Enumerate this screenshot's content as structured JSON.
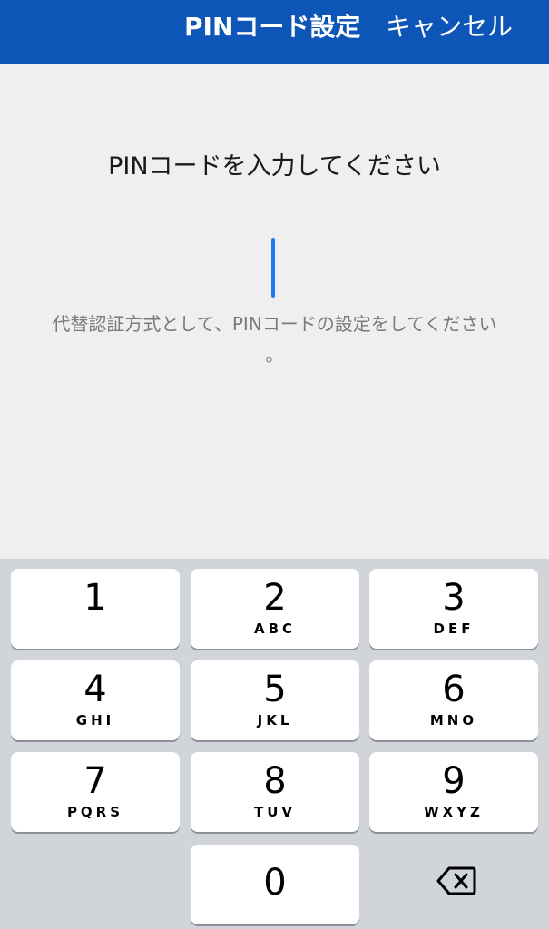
{
  "header": {
    "title": "PINコード設定",
    "cancel_label": "キャンセル",
    "background_color": "#0d56b7"
  },
  "main": {
    "prompt": "PINコードを入力してください",
    "pin_value": "",
    "helper_line1": "代替認証方式として、PINコードの設定をしてください",
    "helper_line2": "。"
  },
  "keypad": {
    "keys": [
      {
        "digit": "1",
        "letters": ""
      },
      {
        "digit": "2",
        "letters": "ABC"
      },
      {
        "digit": "3",
        "letters": "DEF"
      },
      {
        "digit": "4",
        "letters": "GHI"
      },
      {
        "digit": "5",
        "letters": "JKL"
      },
      {
        "digit": "6",
        "letters": "MNO"
      },
      {
        "digit": "7",
        "letters": "PQRS"
      },
      {
        "digit": "8",
        "letters": "TUV"
      },
      {
        "digit": "9",
        "letters": "WXYZ"
      },
      {
        "digit": "0",
        "letters": ""
      }
    ],
    "backspace_icon": "backspace-icon"
  }
}
